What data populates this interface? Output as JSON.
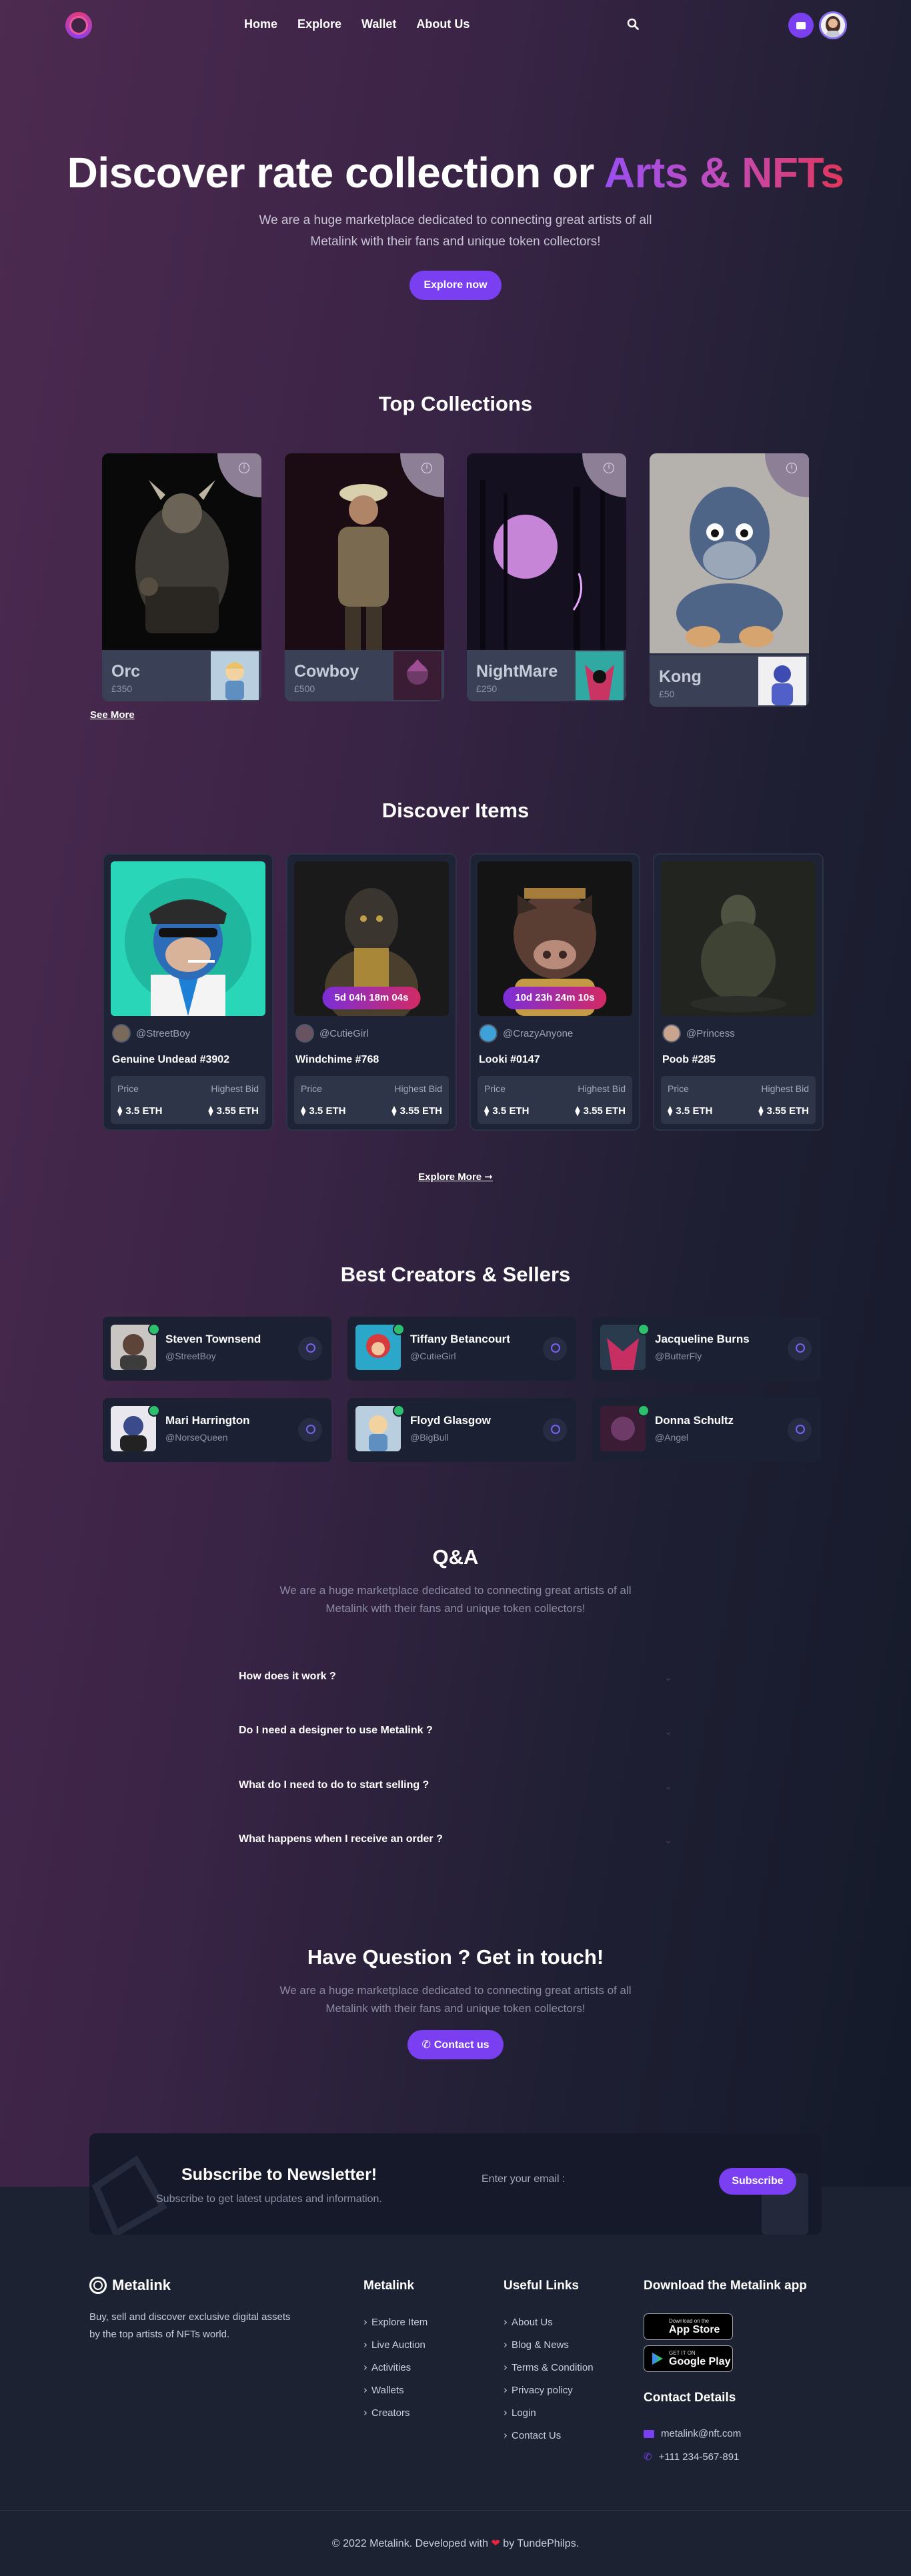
{
  "nav": {
    "items": [
      "Home",
      "Explore",
      "Wallet",
      "About Us"
    ]
  },
  "hero": {
    "title_plain": "Discover rate collection or ",
    "title_gradient": "Arts & NFTs",
    "subtitle": "We are a huge marketplace dedicated to connecting great artists of all Metalink with their fans and unique token collectors!",
    "cta": "Explore now"
  },
  "collections": {
    "title": "Top Collections",
    "items": [
      {
        "name": "Orc",
        "price": "£350"
      },
      {
        "name": "Cowboy",
        "price": "£500"
      },
      {
        "name": "NightMare",
        "price": "£250"
      },
      {
        "name": "Kong",
        "price": "£50"
      }
    ],
    "see_more": "See More"
  },
  "discover": {
    "title": "Discover Items",
    "price_label": "Price",
    "bid_label": "Highest Bid",
    "items": [
      {
        "owner": "@StreetBoy",
        "title": "Genuine Undead #3902",
        "price": "3.5 ETH",
        "bid": "3.55 ETH",
        "timer": ""
      },
      {
        "owner": "@CutieGirl",
        "title": "Windchime #768",
        "price": "3.5 ETH",
        "bid": "3.55 ETH",
        "timer": "5d 04h 18m 04s"
      },
      {
        "owner": "@CrazyAnyone",
        "title": "Looki #0147",
        "price": "3.5 ETH",
        "bid": "3.55 ETH",
        "timer": "10d 23h 24m 10s"
      },
      {
        "owner": "@Princess",
        "title": "Poob #285",
        "price": "3.5 ETH",
        "bid": "3.55 ETH",
        "timer": ""
      }
    ],
    "explore_more": "Explore More ➞"
  },
  "creators": {
    "title": "Best Creators & Sellers",
    "items": [
      {
        "name": "Steven Townsend",
        "handle": "@StreetBoy"
      },
      {
        "name": "Tiffany Betancourt",
        "handle": "@CutieGirl"
      },
      {
        "name": "Jacqueline Burns",
        "handle": "@ButterFly"
      },
      {
        "name": "Mari Harrington",
        "handle": "@NorseQueen"
      },
      {
        "name": "Floyd Glasgow",
        "handle": "@BigBull"
      },
      {
        "name": "Donna Schultz",
        "handle": "@Angel"
      }
    ]
  },
  "qa": {
    "title": "Q&A",
    "subtitle": "We are a huge marketplace dedicated to connecting great artists of all Metalink with their fans and unique token collectors!",
    "questions": [
      "How does it work ?",
      "Do I need a designer to use Metalink ?",
      "What do I need to do to start selling ?",
      "What happens when I receive an order ?"
    ]
  },
  "contact": {
    "title": "Have Question ? Get in touch!",
    "subtitle": "We are a huge marketplace dedicated to connecting great artists of all Metalink with their fans and unique token collectors!",
    "button": "Contact us"
  },
  "newsletter": {
    "title": "Subscribe to Newsletter!",
    "subtitle": "Subscribe to get latest updates and information.",
    "placeholder": "Enter your email :",
    "button": "Subscribe"
  },
  "footer": {
    "brand": "Metalink",
    "description": "Buy, sell and discover exclusive digital assets by the top artists of NFTs world.",
    "col1_title": "Metalink",
    "col1_links": [
      "Explore Item",
      "Live Auction",
      "Activities",
      "Wallets",
      "Creators"
    ],
    "col2_title": "Useful Links",
    "col2_links": [
      "About Us",
      "Blog & News",
      "Terms & Condition",
      "Privacy policy",
      "Login",
      "Contact Us"
    ],
    "app_title": "Download the Metalink app",
    "appstore_small": "Download on the",
    "appstore_big": "App Store",
    "googleplay_small": "GET IT ON",
    "googleplay_big": "Google Play",
    "contact_title": "Contact Details",
    "email": "metalink@nft.com",
    "phone": "+111 234-567-891",
    "copyright_pre": "© 2022 Metalink. Developed with",
    "copyright_post": "by TundePhilps."
  },
  "colors": {
    "accent": "#7b3ff2",
    "verified": "#2cc06c",
    "footer_bg": "#1c2232"
  },
  "icons": [
    "logo-icon",
    "search-icon",
    "wallet-icon",
    "info-icon",
    "eth-icon",
    "follow-icon",
    "verified-icon",
    "phone-icon",
    "email-icon",
    "heart-icon",
    "apple-icon",
    "google-play-icon",
    "chevron-right-icon"
  ]
}
